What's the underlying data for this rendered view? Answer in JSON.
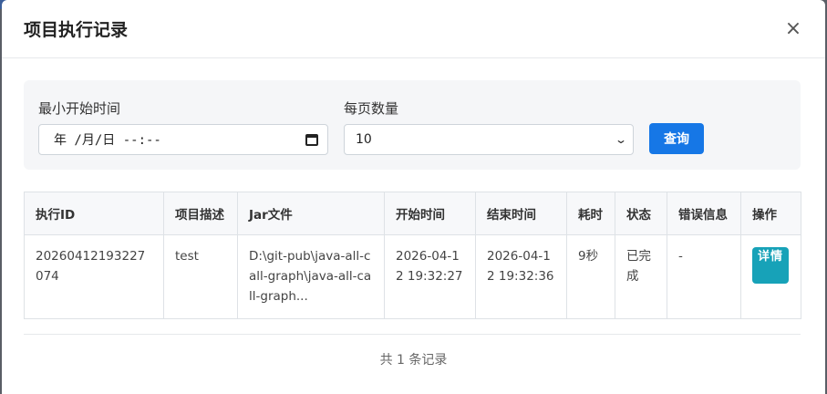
{
  "modal": {
    "title": "项目执行记录",
    "close_glyph": "×"
  },
  "filters": {
    "min_start_label": "最小开始时间",
    "min_start_value": "年 /月/日 --:--",
    "page_size_label": "每页数量",
    "page_size_value": "10",
    "query_label": "查询"
  },
  "table": {
    "headers": [
      "执行ID",
      "项目描述",
      "Jar文件",
      "开始时间",
      "结束时间",
      "耗时",
      "状态",
      "错误信息",
      "操作"
    ],
    "rows": [
      {
        "id": "20260412193227074",
        "desc": "test",
        "jar": "D:\\git-pub\\java-all-call-graph\\java-all-call-graph...",
        "start": "2026-04-12 19:32:27",
        "end": "2026-04-12 19:32:36",
        "duration": "9秒",
        "status": "已完成",
        "error": "-",
        "action_label": "详情"
      }
    ]
  },
  "footer": {
    "summary": "共 1 条记录"
  },
  "colors": {
    "primary": "#1677e6",
    "info": "#17a2b8"
  }
}
